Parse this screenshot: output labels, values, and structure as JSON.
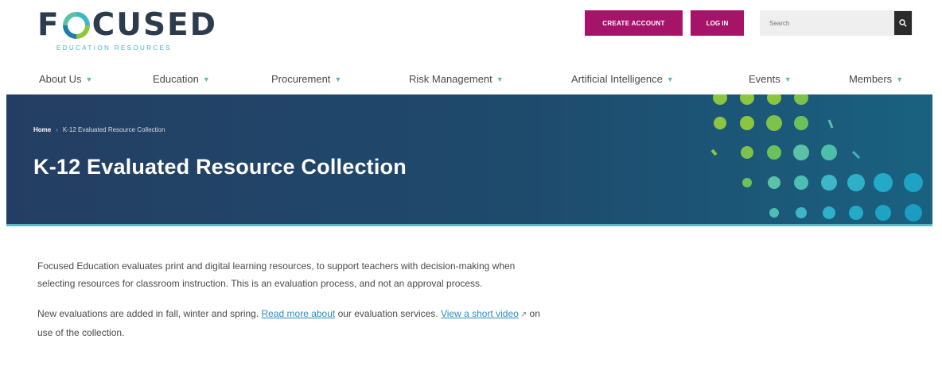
{
  "header": {
    "logo": {
      "word_pre": "F",
      "word_post": "CUSED",
      "subtitle": "EDUCATION RESOURCES"
    },
    "create_account_label": "CREATE ACCOUNT",
    "login_label": "LOG IN",
    "search": {
      "placeholder": "Search"
    },
    "colors": {
      "brand": "#a6146a",
      "navy": "#2d3b4e",
      "teal": "#3fb6c7"
    }
  },
  "nav": {
    "items": [
      {
        "label": "About Us"
      },
      {
        "label": "Education"
      },
      {
        "label": "Procurement"
      },
      {
        "label": "Risk Management"
      },
      {
        "label": "Artificial Intelligence"
      },
      {
        "label": "Events"
      },
      {
        "label": "Members"
      }
    ],
    "chevron_icon": "chevron-down-icon"
  },
  "hero": {
    "breadcrumb_home": "Home",
    "breadcrumb_current": "K-12 Evaluated Resource Collection",
    "title": "K-12 Evaluated Resource Collection"
  },
  "content": {
    "para1": "Focused Education evaluates print and digital learning resources, to support teachers with decision-making when selecting resources for classroom instruction. This is an evaluation process, and not an approval process.",
    "para2_before": "New evaluations are added in fall, winter and spring. ",
    "para2_link1": "Read more about",
    "para2_mid": " our evaluation services. ",
    "para2_link2": "View a short video",
    "para2_after": " on use of the collection.",
    "external_icon": "external-link-icon"
  }
}
